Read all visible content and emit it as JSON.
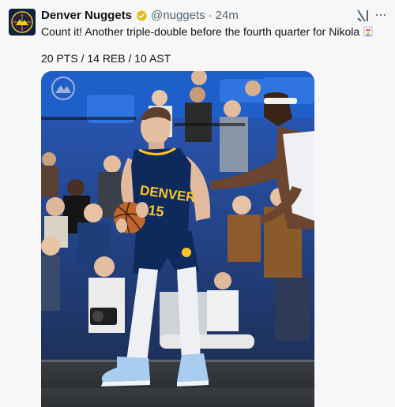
{
  "tweet": {
    "display_name": "Denver Nuggets",
    "handle": "@nuggets",
    "separator": "·",
    "time": "24m",
    "text": "Count it! Another triple-double before the fourth quarter for Nikola",
    "stats_line": "20 PTS / 14 REB / 10 AST"
  },
  "photo": {
    "jersey_text": "DENVER",
    "jersey_number": "15"
  },
  "colors": {
    "verified_badge": "#e2b719",
    "nuggets_navy": "#0d2240",
    "court_seats": "#1f5fc9"
  },
  "icons": {
    "avatar": "nuggets-logo-icon",
    "verified": "verified-badge-icon",
    "grok": "grok-icon",
    "more": "more-icon",
    "emoji": "joker-card-emoji-icon"
  }
}
